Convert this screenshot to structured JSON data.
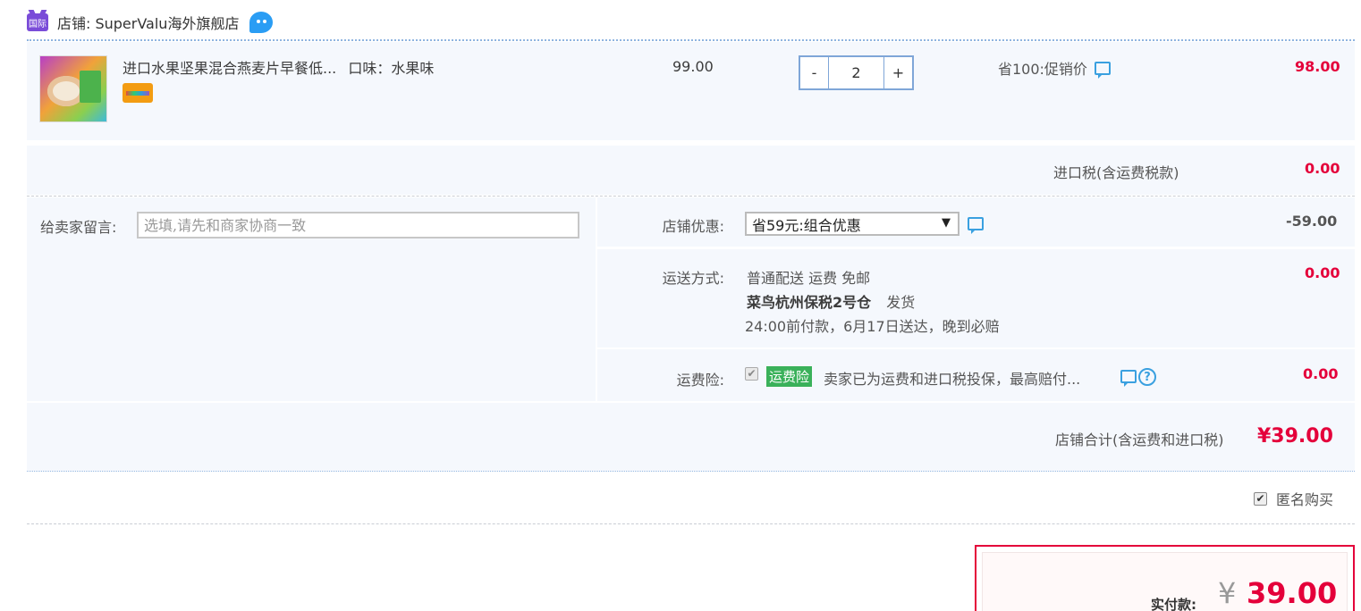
{
  "store": {
    "badge": "国际",
    "label": "店铺: SuperValu海外旗舰店"
  },
  "item": {
    "title": "进口水果坚果混合燕麦片早餐低...",
    "flavor": "口味：水果味",
    "unit_price": "99.00",
    "quantity": "2",
    "minus": "-",
    "plus": "+",
    "promo": "省100:促销价",
    "subtotal": "98.00"
  },
  "tax": {
    "label": "进口税(含运费税款)",
    "amount": "0.00"
  },
  "memo": {
    "label": "给卖家留言:",
    "placeholder": "选填,请先和商家协商一致"
  },
  "coupon": {
    "label": "店铺优惠:",
    "selected": "省59元:组合优惠",
    "amount": "-59.00"
  },
  "shipping": {
    "label": "运送方式:",
    "line1": "普通配送 运费 免邮",
    "warehouse": "菜鸟杭州保税2号仓",
    "dispatch": "发货",
    "line3": "24:00前付款，6月17日送达，晚到必赔",
    "amount": "0.00"
  },
  "insurance": {
    "label": "运费险:",
    "badge": "运费险",
    "text": "卖家已为运费和进口税投保，最高赔付...",
    "amount": "0.00",
    "checked": true
  },
  "total": {
    "label": "店铺合计(含运费和进口税)",
    "amount": "¥39.00"
  },
  "anonymous": {
    "label": "匿名购买",
    "checked": true
  },
  "payment": {
    "label": "实付款:",
    "currency": "¥",
    "amount": "39.00"
  },
  "colors": {
    "accent_red": "#e4003a",
    "panel_bg": "#f5f8fd",
    "link_blue": "#3aa0e0",
    "badge_green": "#3ab15a"
  }
}
